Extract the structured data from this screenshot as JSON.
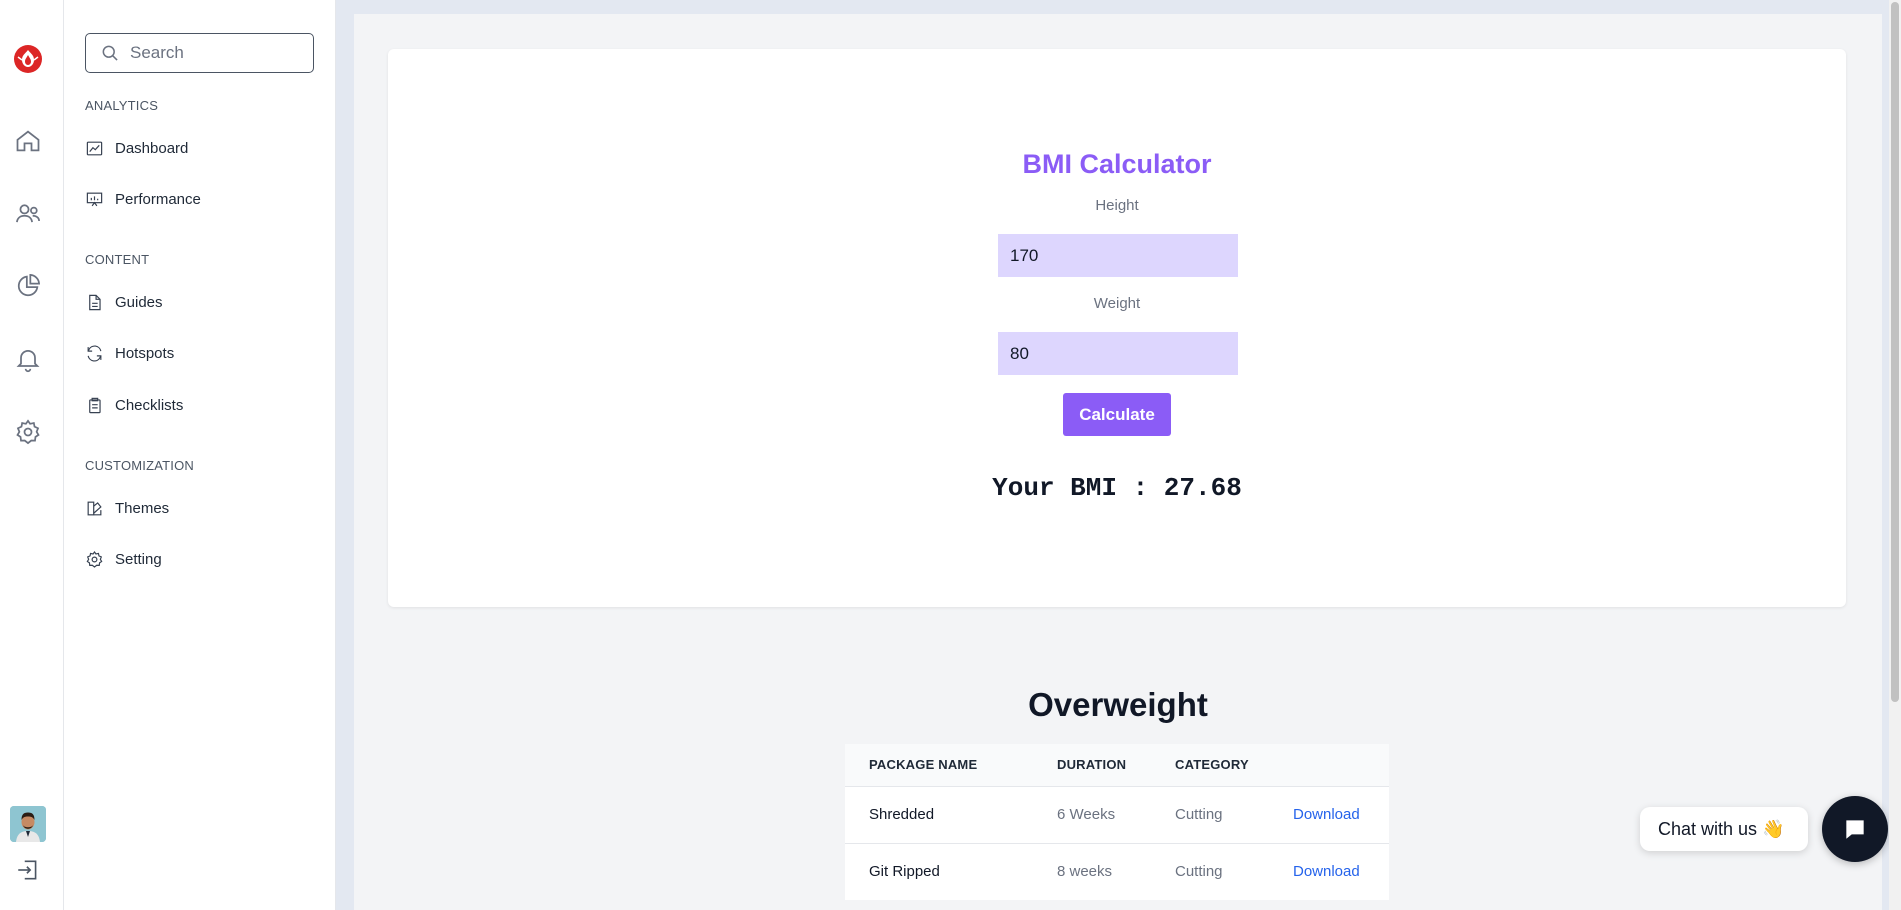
{
  "search": {
    "placeholder": "Search"
  },
  "sections": {
    "analytics": "ANALYTICS",
    "content": "CONTENT",
    "customization": "CUSTOMIZATION"
  },
  "nav": {
    "dashboard": "Dashboard",
    "performance": "Performance",
    "guides": "Guides",
    "hotspots": "Hotspots",
    "checklists": "Checklists",
    "themes": "Themes",
    "setting": "Setting"
  },
  "calculator": {
    "title": "BMI Calculator",
    "height_label": "Height",
    "height_value": "170",
    "weight_label": "Weight",
    "weight_value": "80",
    "button_label": "Calculate",
    "result": "Your BMI : 27.68"
  },
  "result_heading": "Overweight",
  "table": {
    "headers": [
      "PACKAGE NAME",
      "DURATION",
      "CATEGORY",
      ""
    ],
    "rows": [
      {
        "name": "Shredded",
        "duration": "6 Weeks",
        "category": "Cutting",
        "action": "Download"
      },
      {
        "name": "Git Ripped",
        "duration": "8 weeks",
        "category": "Cutting",
        "action": "Download"
      }
    ]
  },
  "chat": {
    "label": "Chat with us 👋"
  },
  "colors": {
    "accent": "#8b5cf6",
    "input_bg": "#ddd6fe",
    "link": "#2563eb",
    "logo": "#dc2626"
  }
}
